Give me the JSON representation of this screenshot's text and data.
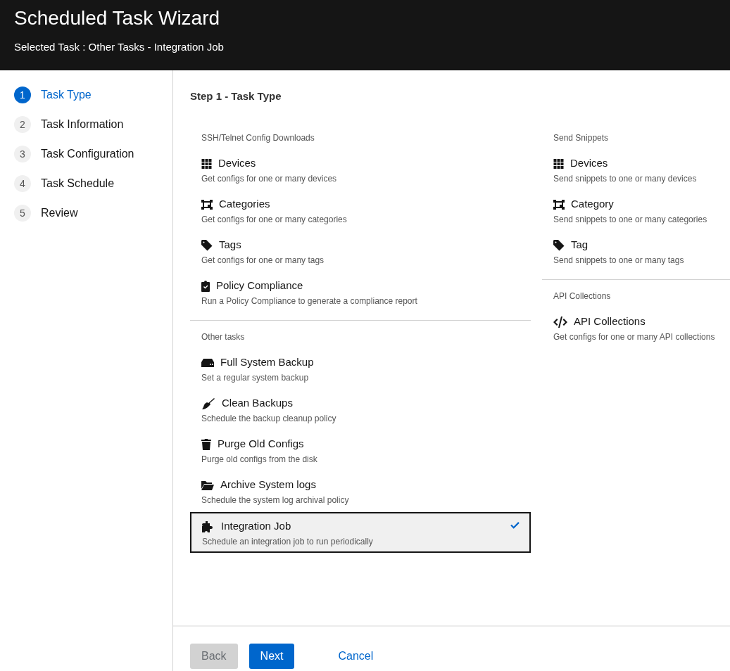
{
  "header": {
    "title": "Scheduled Task Wizard",
    "subtitle": "Selected Task : Other Tasks - Integration Job"
  },
  "steps": [
    {
      "number": "1",
      "label": "Task Type",
      "selected": true
    },
    {
      "number": "2",
      "label": "Task Information",
      "selected": false
    },
    {
      "number": "3",
      "label": "Task Configuration",
      "selected": false
    },
    {
      "number": "4",
      "label": "Task Schedule",
      "selected": false
    },
    {
      "number": "5",
      "label": "Review",
      "selected": false
    }
  ],
  "step_title": "Step 1 - Task Type",
  "columns": [
    {
      "groups": [
        {
          "heading": "SSH/Telnet Config Downloads",
          "items": [
            {
              "kind": "grid",
              "title": "Devices",
              "description": "Get configs for one or many devices",
              "selected": false
            },
            {
              "kind": "category",
              "title": "Categories",
              "description": "Get configs for one or many categories",
              "selected": false
            },
            {
              "kind": "tag",
              "title": "Tags",
              "description": "Get configs for one or many tags",
              "selected": false
            },
            {
              "kind": "clipboard",
              "title": "Policy Compliance",
              "description": "Run a Policy Compliance to generate a compliance report",
              "selected": false
            }
          ]
        },
        {
          "heading": "Other tasks",
          "items": [
            {
              "kind": "drive",
              "title": "Full System Backup",
              "description": "Set a regular system backup",
              "selected": false
            },
            {
              "kind": "broom",
              "title": "Clean Backups",
              "description": "Schedule the backup cleanup policy",
              "selected": false
            },
            {
              "kind": "trash",
              "title": "Purge Old Configs",
              "description": "Purge old configs from the disk",
              "selected": false
            },
            {
              "kind": "folder",
              "title": "Archive System logs",
              "description": "Schedule the system log archival policy",
              "selected": false
            },
            {
              "kind": "puzzle",
              "title": "Integration Job",
              "description": "Schedule an integration job to run periodically",
              "selected": true
            }
          ]
        }
      ]
    },
    {
      "groups": [
        {
          "heading": "Send Snippets",
          "items": [
            {
              "kind": "grid",
              "title": "Devices",
              "description": "Send snippets to one or many devices",
              "selected": false
            },
            {
              "kind": "category",
              "title": "Category",
              "description": "Send snippets to one or many categories",
              "selected": false
            },
            {
              "kind": "tag",
              "title": "Tag",
              "description": "Send snippets to one or many tags",
              "selected": false
            }
          ]
        },
        {
          "heading": "API Collections",
          "items": [
            {
              "kind": "code",
              "title": "API Collections",
              "description": "Get configs for one or many API collections",
              "selected": false
            }
          ]
        }
      ]
    }
  ],
  "buttons": [
    {
      "kind": "secondary",
      "label": "Back",
      "disabled": true
    },
    {
      "kind": "primary",
      "label": "Next",
      "disabled": false
    },
    {
      "kind": "link",
      "label": "Cancel",
      "disabled": false
    }
  ]
}
